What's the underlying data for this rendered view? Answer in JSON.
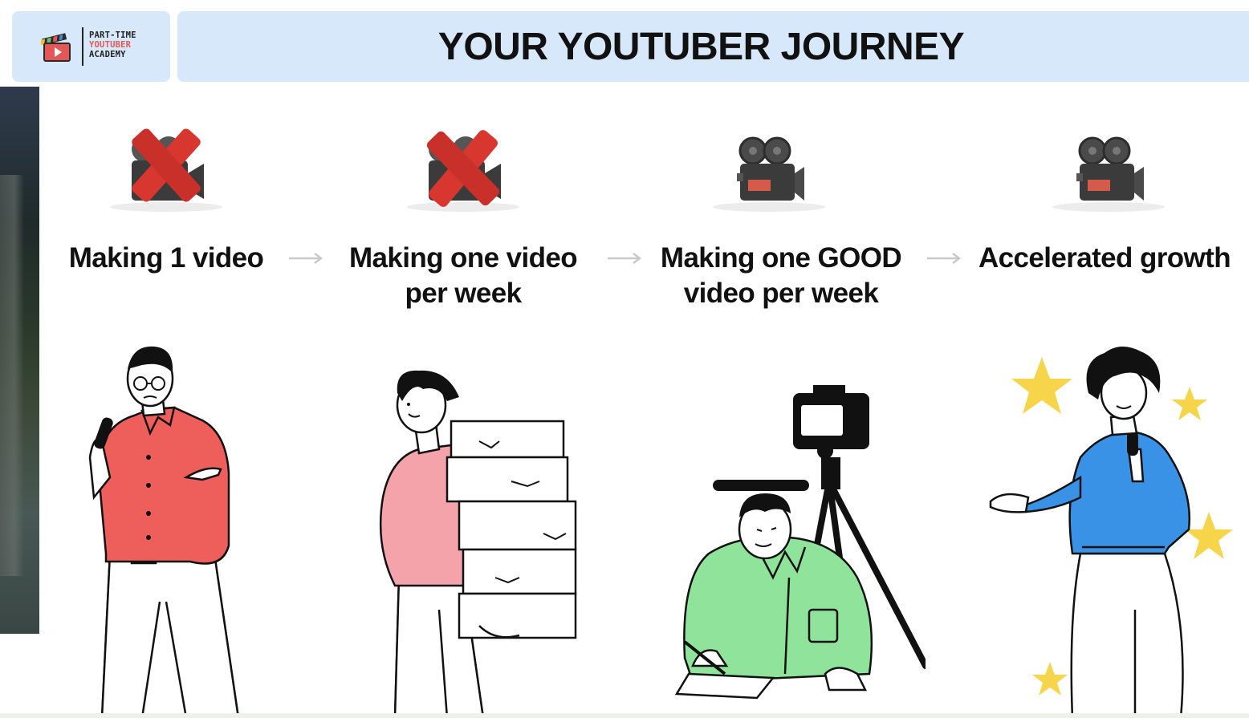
{
  "logo": {
    "line1": "PART-TIME",
    "line2": "YOUTUBER",
    "line3": "ACADEMY",
    "icon": "clapperboard-icon"
  },
  "title": "YOUR YOUTUBER JOURNEY",
  "stages": [
    {
      "label_line1": "Making 1 video",
      "label_line2": "",
      "status_icon": "crossed-camera-icon",
      "crossed": true,
      "figure": "presenter-red-shirt",
      "shirt_color": "#ee5f5b"
    },
    {
      "label_line1": "Making one video",
      "label_line2": "per week",
      "status_icon": "crossed-camera-icon",
      "crossed": true,
      "figure": "person-carrying-boxes",
      "shirt_color": "#f4a3ab"
    },
    {
      "label_line1": "Making one GOOD",
      "label_line2": "video per week",
      "status_icon": "movie-camera-icon",
      "crossed": false,
      "figure": "person-writing-with-camera",
      "shirt_color": "#8fe39a"
    },
    {
      "label_line1": "Accelerated growth",
      "label_line2": "",
      "status_icon": "movie-camera-icon",
      "crossed": false,
      "figure": "presenter-with-stars",
      "shirt_color": "#3a92e6"
    }
  ],
  "colors": {
    "header_bg": "#d7e8fa",
    "cross_red": "#d7372f",
    "star_yellow": "#f7d54a",
    "arrow_gray": "#c9c9c9"
  }
}
